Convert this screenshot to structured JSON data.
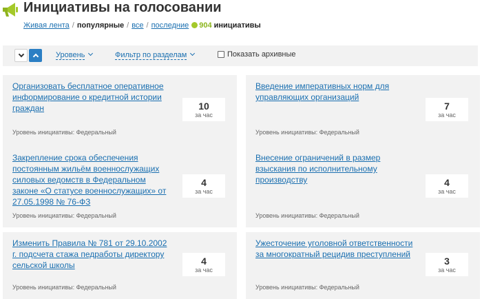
{
  "header": {
    "title": "Инициативы на голосовании",
    "logo_icon": "megaphone-icon",
    "accent_color": "#a4c92a"
  },
  "filters": {
    "live": "Живая лента",
    "popular": "популярные",
    "all": "все",
    "latest": "последние",
    "count": "904",
    "count_label": "инициативы"
  },
  "toolbar": {
    "sort_down_icon": "chevron-down-icon",
    "sort_up_icon": "chevron-up-icon",
    "level_label": "Уровень",
    "section_filter_label": "Фильтр по разделам",
    "archive_label": "Показать архивные"
  },
  "cards": [
    {
      "title": "Организовать бесплатное оперативное информирование о кредитной истории граждан",
      "votes": "10",
      "rate": "за час",
      "level": "Уровень инициативы: Федеральный"
    },
    {
      "title": "Введение императивных норм для управляющих организаций",
      "votes": "7",
      "rate": "за час",
      "level": "Уровень инициативы: Федеральный"
    },
    {
      "title": "Закрепление срока обеспечения постоянным жильём военнослужащих силовых ведомств в Федеральном законе «О статусе военнослужащих» от 27.05.1998 № 76-ФЗ",
      "votes": "4",
      "rate": "за час",
      "level": "Уровень инициативы: Федеральный"
    },
    {
      "title": "Внесение ограничений в размер взыскания по исполнительному производству",
      "votes": "4",
      "rate": "за час",
      "level": "Уровень инициативы: Федеральный"
    },
    {
      "title": "Изменить Правила № 781 от 29.10.2002 г. подсчета стажа педработы директору сельской школы",
      "votes": "4",
      "rate": "за час",
      "level": "Уровень инициативы: Федеральный"
    },
    {
      "title": "Ужесточение уголовной ответственности за многократный рецидив преступлений",
      "votes": "3",
      "rate": "за час",
      "level": "Уровень инициативы: Федеральный"
    }
  ]
}
